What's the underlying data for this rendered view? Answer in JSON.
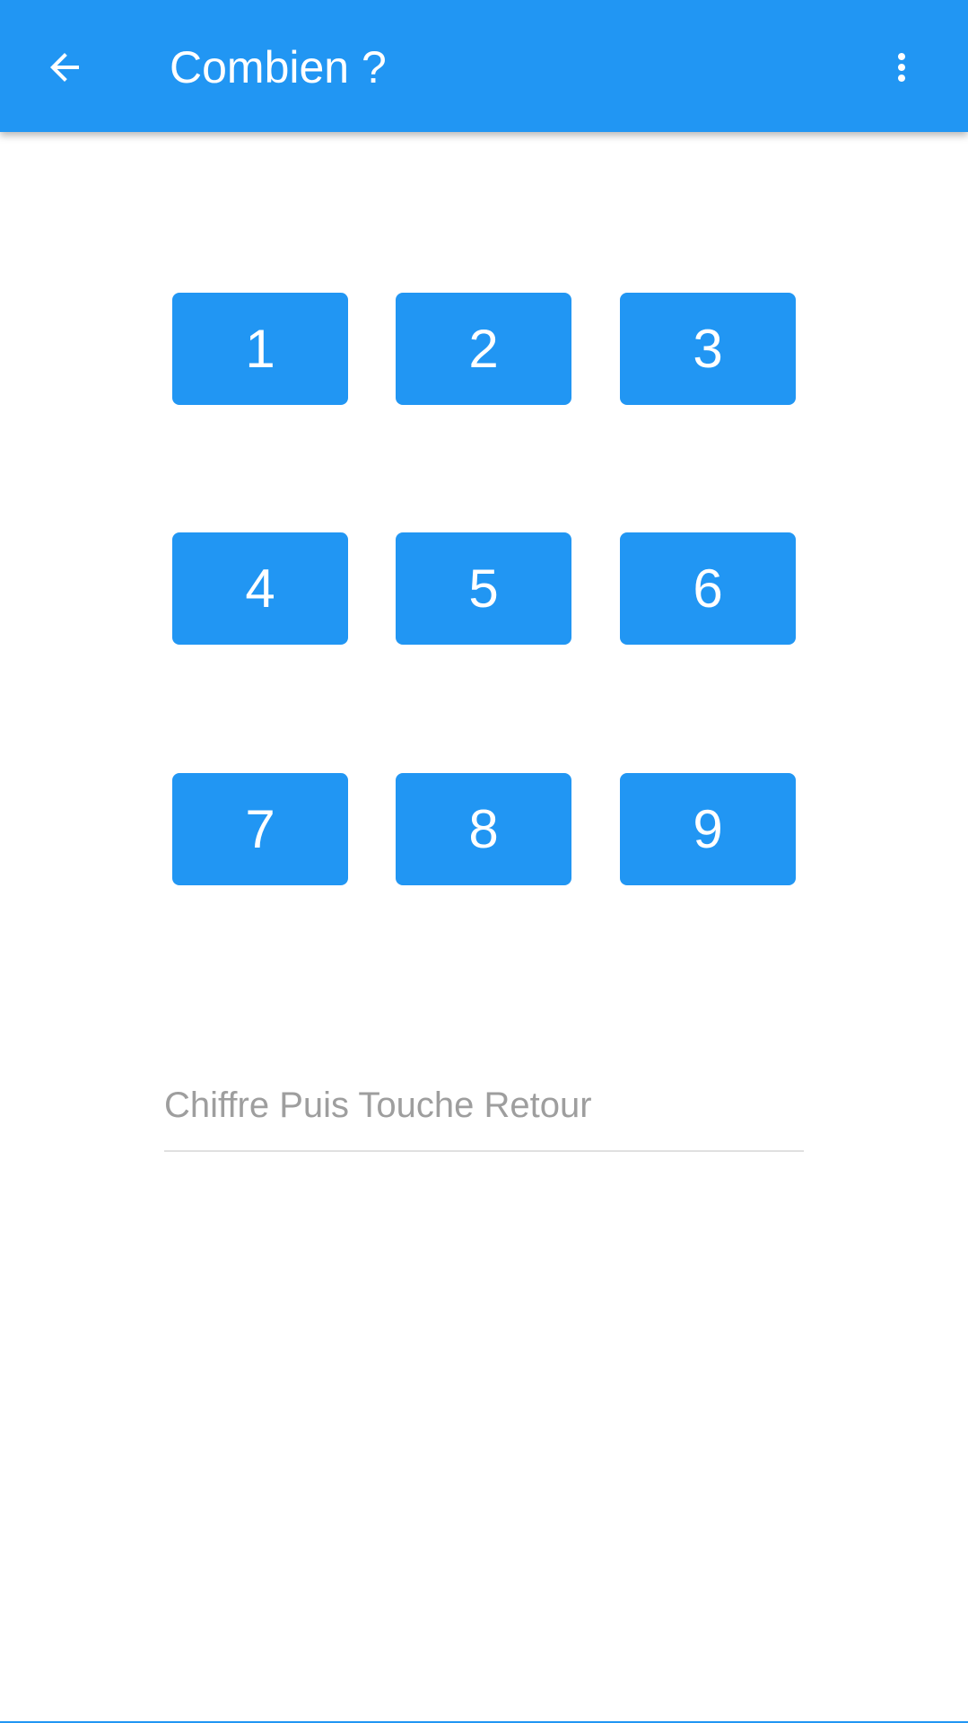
{
  "app_bar": {
    "title": "Combien ?",
    "back_icon": "arrow-back-icon",
    "overflow_icon": "more-vert-icon",
    "color": "#2196F3"
  },
  "keypad": {
    "keys": [
      "1",
      "2",
      "3",
      "4",
      "5",
      "6",
      "7",
      "8",
      "9"
    ],
    "key_color": "#2196F3",
    "text_color": "#FFFFFF"
  },
  "input": {
    "value": "",
    "placeholder": "Chiffre Puis Touche Retour"
  }
}
